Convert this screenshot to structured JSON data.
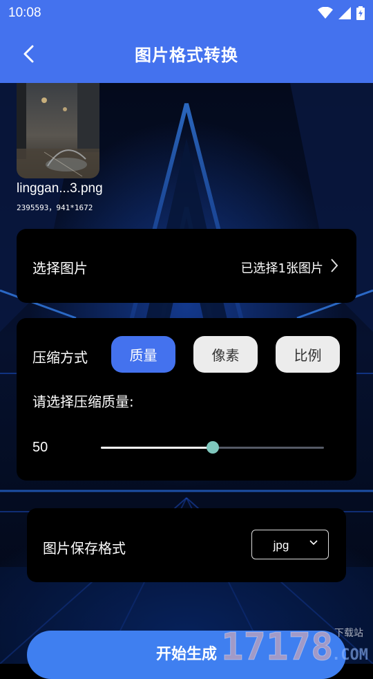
{
  "status_bar": {
    "time": "10:08"
  },
  "header": {
    "title": "图片格式转换"
  },
  "preview": {
    "file_name": "linggan...3.png",
    "file_meta": "2395593，941*1672"
  },
  "select_image": {
    "label": "选择图片",
    "value": "已选择1张图片"
  },
  "compression": {
    "label": "压缩方式",
    "options": [
      "质量",
      "像素",
      "比例"
    ],
    "selected": "质量",
    "quality_prompt": "请选择压缩质量:",
    "quality_value": "50",
    "quality_fraction": 0.5
  },
  "save_format": {
    "label": "图片保存格式",
    "value": "jpg"
  },
  "generate_button": {
    "label": "开始生成"
  },
  "watermark": {
    "text": "17178",
    "suffix": ".COM",
    "tag": "下载站"
  },
  "colors": {
    "accent": "#4472ee",
    "button_blue": "#3f7ff0",
    "slider_thumb": "#7fc7bd",
    "card_bg": "#000000"
  }
}
